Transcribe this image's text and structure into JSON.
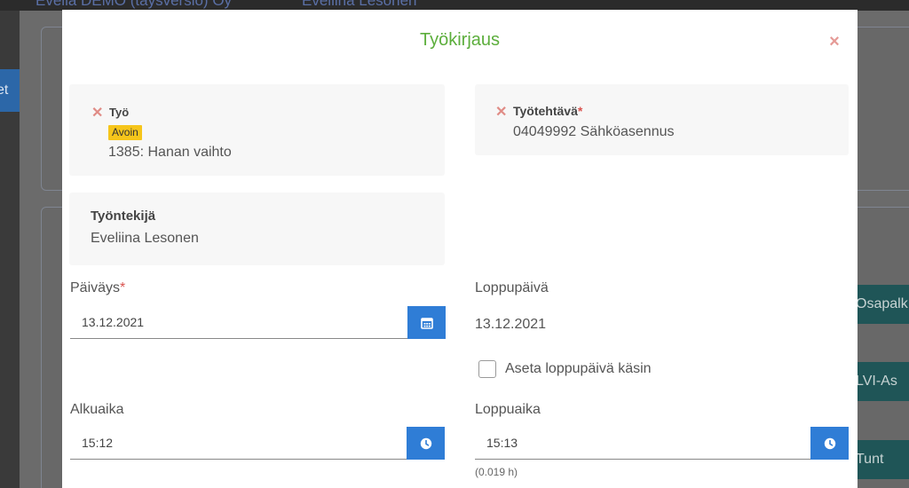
{
  "app": {
    "company_name": "Evelia DEMO (täysversio) Oy",
    "user_name": "Eveliina Lesonen",
    "left_tab_label": "et",
    "right_buttons": [
      "Osapalk",
      "LVI-As",
      "Tunt"
    ]
  },
  "modal": {
    "title": "Työkirjaus",
    "work": {
      "label": "Työ",
      "status_badge": "Avoin",
      "value": "1385: Hanan vaihto"
    },
    "task": {
      "label": "Työtehtävä",
      "required_mark": "*",
      "value": "04049992 Sähköasennus"
    },
    "employee": {
      "label": "Työntekijä",
      "value": "Eveliina Lesonen"
    },
    "date": {
      "label": "Päiväys",
      "required_mark": "*",
      "value": "13.12.2021"
    },
    "end_date": {
      "label": "Loppupäivä",
      "value": "13.12.2021",
      "manual_checkbox_label": "Aseta loppupäivä käsin",
      "manual_checked": false
    },
    "start_time": {
      "label": "Alkuaika",
      "value": "15:12"
    },
    "end_time": {
      "label": "Loppuaika",
      "value": "15:13",
      "duration": "(0.019 h)"
    }
  },
  "colors": {
    "title_green": "#5cae3c",
    "button_blue": "#2f7dd6",
    "badge_yellow": "#f6c51b",
    "remove_red": "#e08c86"
  }
}
